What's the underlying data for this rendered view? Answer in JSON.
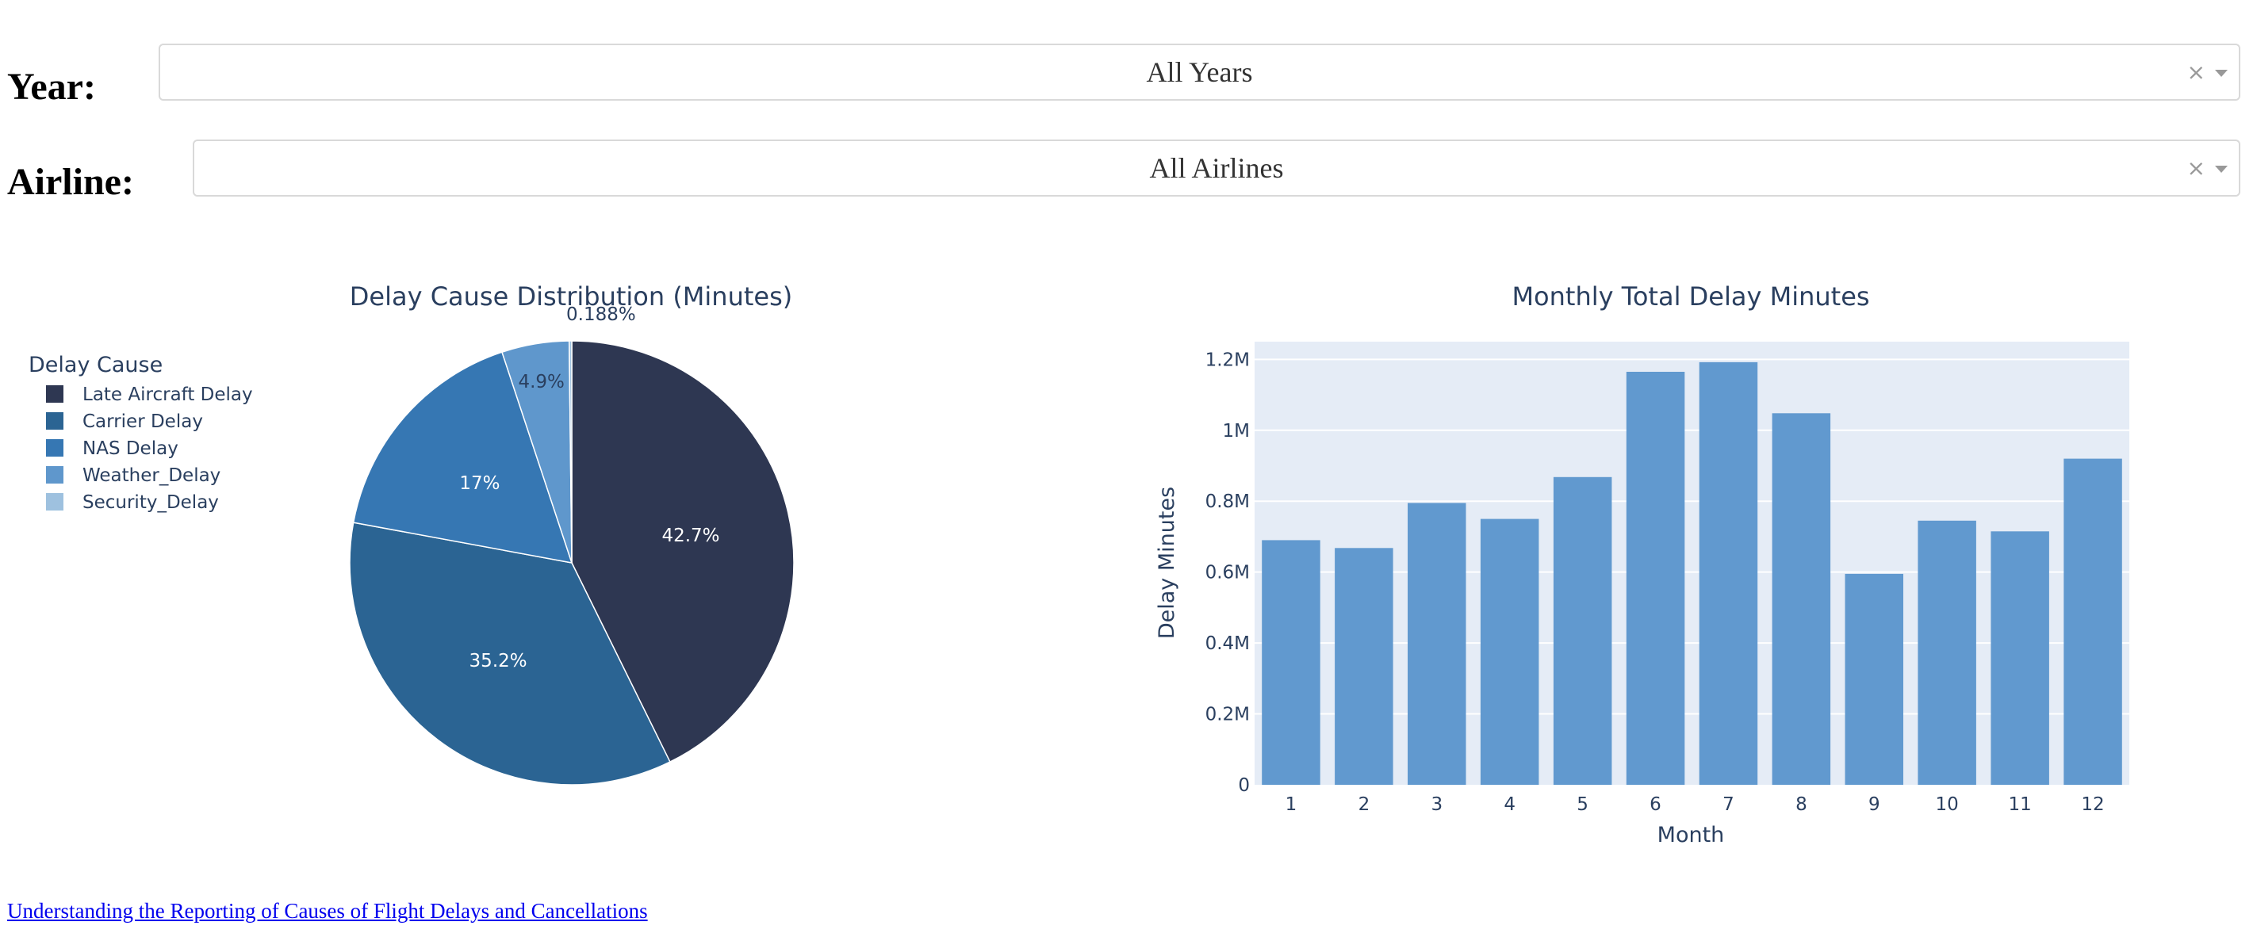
{
  "filters": {
    "year": {
      "label": "Year:",
      "value": "All Years",
      "clear_glyph": "×"
    },
    "airline": {
      "label": "Airline:",
      "value": "All Airlines",
      "clear_glyph": "×"
    }
  },
  "pie_chart": {
    "title": "Delay Cause Distribution (Minutes)",
    "legend_title": "Delay Cause"
  },
  "bar_chart": {
    "title": "Monthly Total Delay Minutes",
    "xlabel": "Month",
    "ylabel": "Delay Minutes"
  },
  "footer": {
    "link_text": "Understanding the Reporting of Causes of Flight Delays and Cancellations"
  },
  "chart_data": [
    {
      "type": "pie",
      "title": "Delay Cause Distribution (Minutes)",
      "legend_title": "Delay Cause",
      "legend_position": "top-left",
      "labels": [
        "Late Aircraft Delay",
        "Carrier Delay",
        "NAS Delay",
        "Weather_Delay",
        "Security_Delay"
      ],
      "values": [
        42.7,
        35.2,
        17.0,
        4.9,
        0.188
      ],
      "text_labels": [
        "42.7%",
        "35.2%",
        "17%",
        "4.9%",
        "0.188%"
      ],
      "colors": [
        "#2e3752",
        "#2b6493",
        "#3677b3",
        "#5f97cc",
        "#9ec1df"
      ]
    },
    {
      "type": "bar",
      "title": "Monthly Total Delay Minutes",
      "xlabel": "Month",
      "ylabel": "Delay Minutes",
      "categories": [
        "1",
        "2",
        "3",
        "4",
        "5",
        "6",
        "7",
        "8",
        "9",
        "10",
        "11",
        "12"
      ],
      "values": [
        690000,
        668000,
        795000,
        750000,
        868000,
        1165000,
        1192000,
        1048000,
        595000,
        745000,
        715000,
        920000
      ],
      "ylim": [
        0,
        1250000
      ],
      "yticks": [
        0,
        200000,
        400000,
        600000,
        800000,
        1000000,
        1200000
      ],
      "ytick_labels": [
        "0",
        "0.2M",
        "0.4M",
        "0.6M",
        "0.8M",
        "1M",
        "1.2M"
      ],
      "grid": true,
      "bar_color": "#6199cf",
      "plot_background": "#e5ecf6"
    }
  ]
}
